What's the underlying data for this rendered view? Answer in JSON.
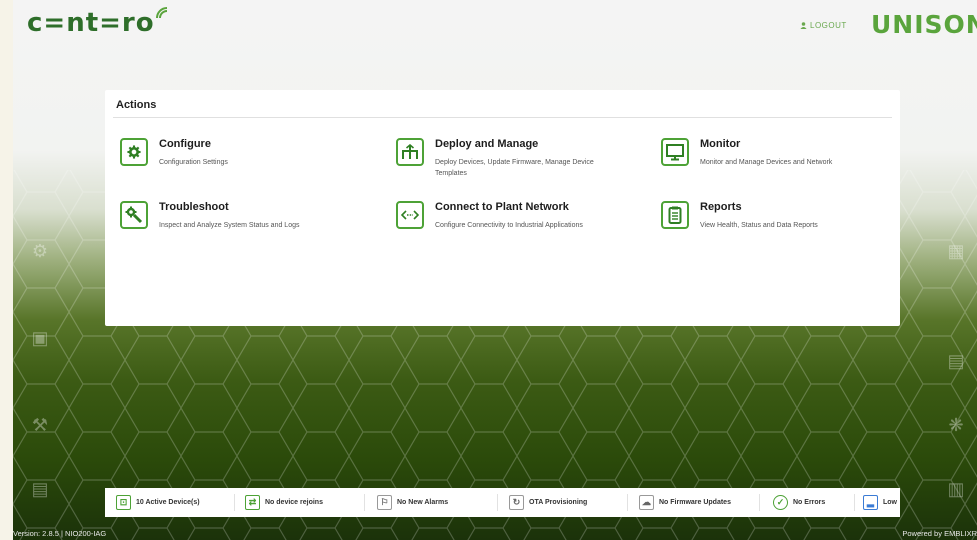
{
  "header": {
    "brand_left": "c=nt=ro",
    "logout_label": "LOGOUT",
    "brand_right": "UNISON"
  },
  "actions": {
    "title": "Actions",
    "items": [
      {
        "title": "Configure",
        "desc": "Configuration Settings",
        "icon": "gear-icon"
      },
      {
        "title": "Deploy and Manage",
        "desc": "Deploy Devices, Update Firmware, Manage Device Templates",
        "icon": "deploy-icon"
      },
      {
        "title": "Monitor",
        "desc": "Monitor and Manage Devices and Network",
        "icon": "monitor-icon"
      },
      {
        "title": "Troubleshoot",
        "desc": "Inspect and Analyze System Status and Logs",
        "icon": "wrench-gear-icon"
      },
      {
        "title": "Connect to Plant Network",
        "desc": "Configure Connectivity to Industrial Applications",
        "icon": "connect-icon"
      },
      {
        "title": "Reports",
        "desc": "View Health, Status and Data Reports",
        "icon": "report-icon"
      }
    ]
  },
  "status_bar": {
    "items": [
      {
        "label": "10 Active Device(s)",
        "icon": "device-icon"
      },
      {
        "label": "No device rejoins",
        "icon": "rejoin-icon"
      },
      {
        "label": "No New Alarms",
        "icon": "alarm-icon"
      },
      {
        "label": "OTA Provisioning",
        "icon": "ota-icon"
      },
      {
        "label": "No Firmware Updates",
        "icon": "cloud-icon"
      },
      {
        "label": "No Errors",
        "icon": "check-circle-icon"
      },
      {
        "label": "Low",
        "icon": "signal-icon"
      }
    ]
  },
  "footer": {
    "version": "Version: 2.8.5 | NIO200-IAG",
    "powered_by": "Powered by EMBLIXR"
  },
  "colors": {
    "brand_green": "#4da236",
    "dark_green": "#2e6e2a",
    "accent_blue": "#3a7bd5"
  }
}
